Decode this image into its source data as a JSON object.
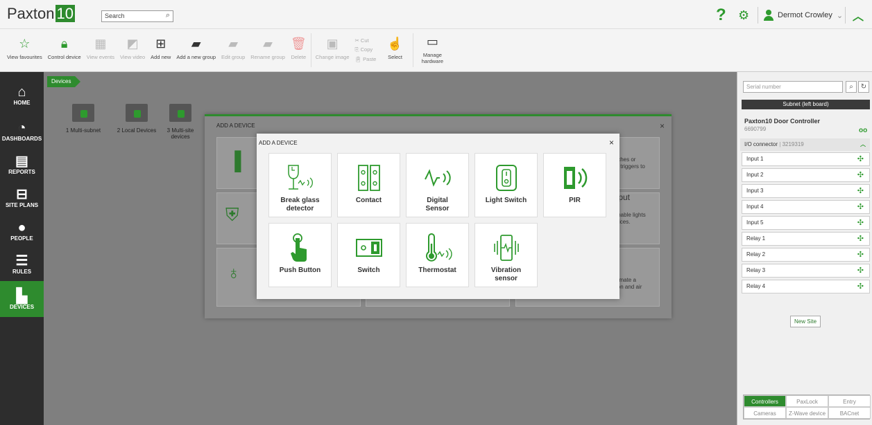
{
  "app": {
    "logo_text": "Paxton",
    "logo_num": "10",
    "search_placeholder": "Search",
    "user_name": "Dermot Crowley"
  },
  "toolbar": {
    "view_favourites": "View favourites",
    "control_device": "Control device",
    "view_events": "View events",
    "view_video": "View video",
    "add_new": "Add new",
    "add_new_group": "Add a new group",
    "edit_group": "Edit group",
    "rename_group": "Rename group",
    "delete": "Delete",
    "change_image": "Change image",
    "cut": "Cut",
    "copy": "Copy",
    "paste": "Paste",
    "select": "Select",
    "manage_hardware_1": "Manage",
    "manage_hardware_2": "hardware"
  },
  "sidebar": {
    "home": "HOME",
    "dashboards": "DASHBOARDS",
    "reports": "REPORTS",
    "site_plans": "SITE PLANS",
    "people": "PEOPLE",
    "rules": "RULES",
    "devices": "DEVICES"
  },
  "main": {
    "breadcrumb": "Devices",
    "folders": [
      {
        "label": "1 Multi-subnet"
      },
      {
        "label": "2 Local Devices"
      },
      {
        "label": "3 Multi-site devices"
      }
    ]
  },
  "right_panel": {
    "serial_placeholder": "Serial number",
    "subnet_label": "Subnet (left board)",
    "controller_name": "Paxton10 Door Controller",
    "controller_serial": "6690799",
    "io_label": "I/O connector",
    "io_serial": "3219319",
    "io_rows": [
      "Input 1",
      "Input 2",
      "Input 3",
      "Input 4",
      "Input 5",
      "Relay 1",
      "Relay 2",
      "Relay 3",
      "Relay 4"
    ],
    "new_site": "New Site",
    "tabs": [
      "Controllers",
      "PaxLock",
      "Entry",
      "Cameras",
      "Z-Wave device",
      "BACnet"
    ]
  },
  "outer_modal": {
    "title": "ADD A DEVICE",
    "card_text_1a": "tches or",
    "card_text_1b": "s triggers to",
    "card_title_2": "tput",
    "card_text_2a": "mable lights",
    "card_text_2b": "vices.",
    "card_text_3a": "omate a",
    "card_text_3b": "ion and air"
  },
  "inner_modal": {
    "title": "ADD A DEVICE",
    "devices": [
      {
        "label_1": "Break glass",
        "label_2": "detector",
        "icon": "break-glass-icon"
      },
      {
        "label_1": "Contact",
        "label_2": "",
        "icon": "contact-icon"
      },
      {
        "label_1": "Digital",
        "label_2": "Sensor",
        "icon": "digital-sensor-icon"
      },
      {
        "label_1": "Light Switch",
        "label_2": "",
        "icon": "light-switch-icon"
      },
      {
        "label_1": "PIR",
        "label_2": "",
        "icon": "pir-icon"
      },
      {
        "label_1": "Push Button",
        "label_2": "",
        "icon": "push-button-icon"
      },
      {
        "label_1": "Switch",
        "label_2": "",
        "icon": "switch-icon"
      },
      {
        "label_1": "Thermostat",
        "label_2": "",
        "icon": "thermostat-icon"
      },
      {
        "label_1": "Vibration",
        "label_2": "sensor",
        "icon": "vibration-sensor-icon"
      }
    ]
  },
  "colors": {
    "accent": "#2e8b2e",
    "sidebar": "#2d2d2d",
    "overlay": "#7f7f7f"
  }
}
